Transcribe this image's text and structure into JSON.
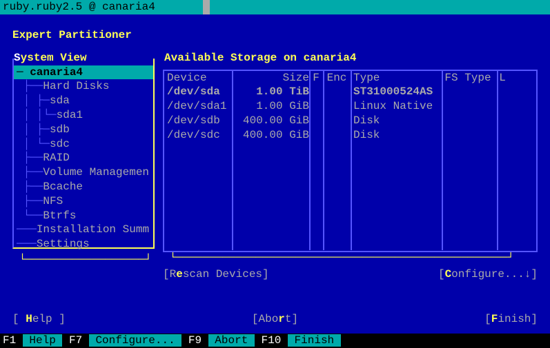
{
  "titlebar": "ruby.ruby2.5 @ canaria4",
  "heading": "Expert Partitioner",
  "tree": {
    "title_pre": "S",
    "title_rest": "ystem View",
    "selected": "canaria4",
    "items": [
      "Hard Disks",
      "sda",
      "sda1",
      "sdb",
      "sdc",
      "RAID",
      "Volume Managemen",
      "Bcache",
      "NFS",
      "Btrfs",
      "Installation Summ",
      "Settings"
    ]
  },
  "right": {
    "title": "Available Storage on canaria4",
    "headers": {
      "device": "Device",
      "size": "Size",
      "f": "F",
      "enc": "Enc",
      "type": "Type",
      "fs": "FS Type",
      "l": "L"
    },
    "rows": [
      {
        "device": "/dev/sda",
        "size": "1.00 TiB",
        "type": "ST31000524AS",
        "selected": true
      },
      {
        "device": "/dev/sda1",
        "size": "1.00 GiB",
        "type": "Linux Native"
      },
      {
        "device": "/dev/sdb",
        "size": "400.00 GiB",
        "type": "Disk"
      },
      {
        "device": "/dev/sdc",
        "size": "400.00 GiB",
        "type": "Disk"
      }
    ],
    "rescan_pre": "[R",
    "rescan_hot": "e",
    "rescan_post": "scan Devices]",
    "configure_pre": "[",
    "configure_hot": "C",
    "configure_post": "onfigure...↓]"
  },
  "buttons": {
    "help_pre": "[ ",
    "help_hot": "H",
    "help_post": "elp ]",
    "abort_pre": "[Abo",
    "abort_hot": "r",
    "abort_post": "t]",
    "finish_pre": "[",
    "finish_hot": "F",
    "finish_post": "inish]"
  },
  "fbar": {
    "f1": "F1",
    "f1_lbl": " Help ",
    "f7": "F7",
    "f7_lbl": " Configure... ",
    "f9": "F9",
    "f9_lbl": " Abort ",
    "f10": "F10",
    "f10_lbl": " Finish "
  }
}
